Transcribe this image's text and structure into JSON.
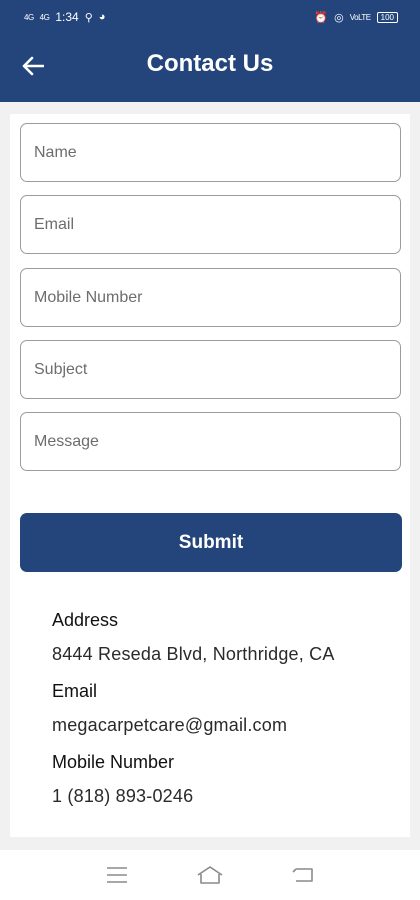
{
  "status_bar": {
    "signal_1": "4G",
    "signal_2": "4G",
    "time": "1:34",
    "battery": "100",
    "network": "VoLTE"
  },
  "header": {
    "title": "Contact Us",
    "back_icon": "arrow-left-icon"
  },
  "form": {
    "name_placeholder": "Name",
    "email_placeholder": "Email",
    "mobile_placeholder": "Mobile Number",
    "subject_placeholder": "Subject",
    "message_placeholder": "Message",
    "submit_label": "Submit"
  },
  "contact_info": {
    "address_label": "Address",
    "address_value": "8444 Reseda Blvd, Northridge, CA",
    "email_label": "Email",
    "email_value": "megacarpetcare@gmail.com",
    "mobile_label": "Mobile Number",
    "mobile_value": "1 (818) 893-0246"
  },
  "colors": {
    "brand": "#24457c",
    "background": "#f1f1f1",
    "field_border": "#9c9c9c"
  },
  "nav_bar": {
    "icons": [
      "menu-icon",
      "home-icon",
      "back-icon"
    ]
  }
}
